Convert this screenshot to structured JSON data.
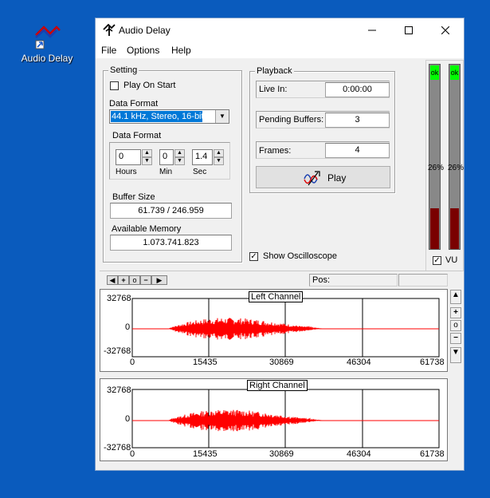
{
  "desktop": {
    "shortcut_label": "Audio Delay"
  },
  "window": {
    "title": "Audio Delay",
    "menu": [
      "File",
      "Options",
      "Help"
    ]
  },
  "setting": {
    "title": "Setting",
    "play_on_start_label": "Play On Start",
    "play_on_start_checked": false,
    "data_format_label": "Data Format",
    "data_format_value": "44.1 kHz, Stereo, 16-bit",
    "delay_group_title": "Data Format",
    "hours_value": "0",
    "min_value": "0",
    "sec_value": "1.4",
    "hours_label": "Hours",
    "min_label": "Min",
    "sec_label": "Sec",
    "buffer_size_label": "Buffer Size",
    "buffer_size_value": "61.739 / 246.959",
    "available_memory_label": "Available Memory",
    "available_memory_value": "1.073.741.823"
  },
  "playback": {
    "title": "Playback",
    "live_in_label": "Live In:",
    "live_in_value": "0:00:00",
    "pending_label": "Pending Buffers:",
    "pending_value": "3",
    "frames_label": "Frames:",
    "frames_value": "4",
    "play_label": "Play",
    "show_osc_label": "Show Oscilloscope",
    "show_osc_checked": true
  },
  "vu": {
    "left": {
      "status": "ok",
      "percent_label": "26%",
      "level": 0.26
    },
    "right": {
      "status": "ok",
      "percent_label": "26%",
      "level": 0.26
    },
    "checkbox_label": "VU",
    "checked": true
  },
  "toolbar": {
    "pos_label": "Pos:"
  },
  "graphs": {
    "left": {
      "title": "Left Channel",
      "y_ticks": [
        "32768",
        "0",
        "-32768"
      ],
      "x_ticks": [
        "0",
        "15435",
        "30869",
        "46304",
        "61738"
      ]
    },
    "right": {
      "title": "Right Channel",
      "y_ticks": [
        "32768",
        "0",
        "-32768"
      ],
      "x_ticks": [
        "0",
        "15435",
        "30869",
        "46304",
        "61738"
      ]
    }
  },
  "colors": {
    "waveform": "#ff0000",
    "vu_ok": "#00ff00",
    "vu_bar": "#7a0000",
    "desktop": "#0a5bbd"
  }
}
